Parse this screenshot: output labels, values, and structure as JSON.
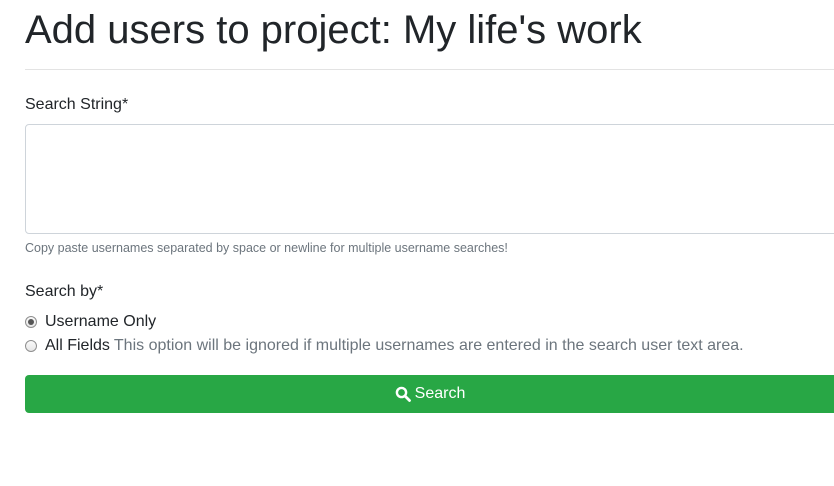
{
  "page": {
    "title": "Add users to project: My life's work"
  },
  "form": {
    "search_string": {
      "label": "Search String*",
      "value": "",
      "help": "Copy paste usernames separated by space or newline for multiple username searches!"
    },
    "search_by": {
      "label": "Search by*",
      "options": [
        {
          "label": "Username Only",
          "note": "",
          "selected": true
        },
        {
          "label": "All Fields",
          "note": "This option will be ignored if multiple usernames are entered in the search user text area.",
          "selected": false
        }
      ]
    },
    "search_button": {
      "label": "Search",
      "icon": "search-icon",
      "color": "#28a745"
    }
  }
}
